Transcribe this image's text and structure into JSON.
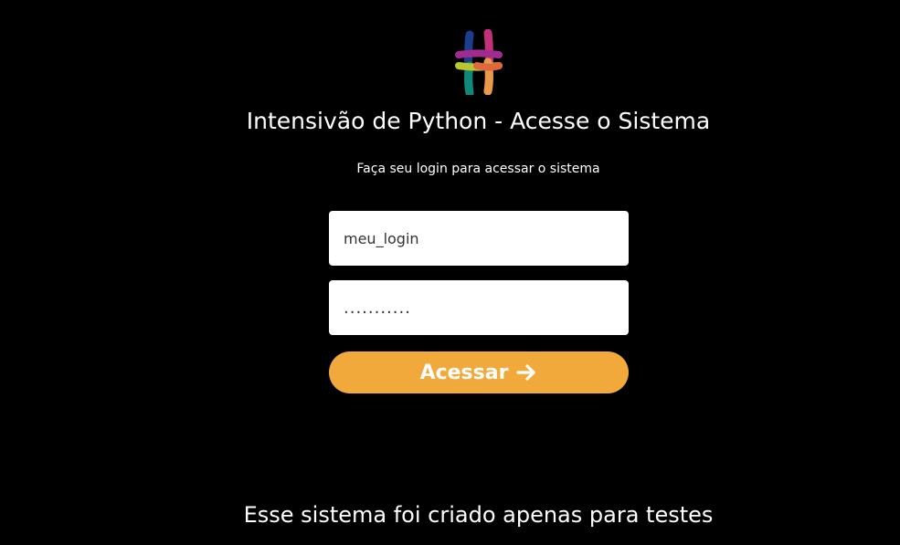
{
  "header": {
    "logo_icon": "hash-ribbon-logo",
    "title": "Intensivão de Python - Acesse o Sistema",
    "subtitle": "Faça seu login para acessar o sistema"
  },
  "form": {
    "login_value": "meu_login",
    "password_value": "...........",
    "submit_label": "Acessar",
    "submit_icon": "arrow-right-icon",
    "submit_color": "#f2a93b"
  },
  "footer": {
    "note": "Esse sistema foi criado apenas para testes"
  }
}
